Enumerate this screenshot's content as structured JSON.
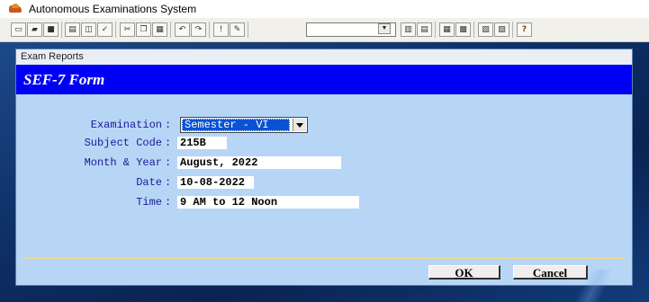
{
  "window": {
    "title": "Autonomous Examinations System",
    "icon": "app-fox-icon"
  },
  "toolbar": {
    "buttons": [
      {
        "name": "new-icon",
        "glyph": "▭"
      },
      {
        "name": "open-icon",
        "glyph": "▰"
      },
      {
        "name": "save-icon",
        "glyph": "■"
      },
      {
        "name": "print-icon",
        "glyph": "▤"
      },
      {
        "name": "print-preview-icon",
        "glyph": "◫"
      },
      {
        "name": "spell-check-icon",
        "glyph": "✓"
      },
      {
        "name": "cut-icon",
        "glyph": "✂"
      },
      {
        "name": "copy-icon",
        "glyph": "❐"
      },
      {
        "name": "paste-icon",
        "glyph": "▦"
      },
      {
        "name": "undo-icon",
        "glyph": "↶"
      },
      {
        "name": "redo-icon",
        "glyph": "↷"
      },
      {
        "name": "run-icon",
        "glyph": "!"
      },
      {
        "name": "modify-icon",
        "glyph": "✎"
      },
      {
        "name": "form-icon",
        "glyph": "▥"
      },
      {
        "name": "report-icon",
        "glyph": "▤"
      },
      {
        "name": "data-icon",
        "glyph": "▦"
      },
      {
        "name": "table-icon",
        "glyph": "▩"
      },
      {
        "name": "command-icon",
        "glyph": "▧"
      },
      {
        "name": "tools-icon",
        "glyph": "▨"
      },
      {
        "name": "help-icon",
        "glyph": "?"
      }
    ],
    "combo_value": ""
  },
  "dialog": {
    "caption": "Exam Reports",
    "form_title": "SEF-7 Form",
    "fields": {
      "examination": {
        "label": "Examination",
        "value": "Semester - VI"
      },
      "subject_code": {
        "label": "Subject Code",
        "value": "215B"
      },
      "month_year": {
        "label": "Month & Year",
        "value": "August, 2022"
      },
      "date": {
        "label": "Date",
        "value": "10-08-2022"
      },
      "time": {
        "label": "Time",
        "value": "9 AM to 12 Noon"
      }
    },
    "colon": ":",
    "ok_label": "OK",
    "cancel_label": "Cancel"
  }
}
